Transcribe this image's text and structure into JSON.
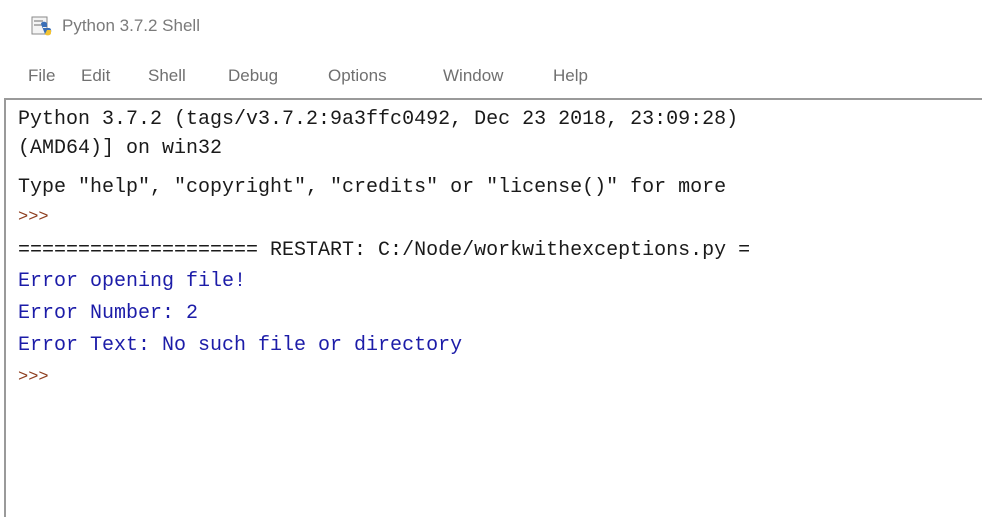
{
  "window": {
    "title": "Python 3.7.2 Shell"
  },
  "menu": {
    "items": [
      "File",
      "Edit",
      "Shell",
      "Debug",
      "Options",
      "Window",
      "Help"
    ]
  },
  "shell": {
    "lines": [
      "Python 3.7.2 (tags/v3.7.2:9a3ffc0492, Dec 23 2018, 23:09:28)",
      "(AMD64)] on win32",
      "Type \"help\", \"copyright\", \"credits\" or \"license()\" for more",
      ">>>",
      "==================== RESTART: C:/Node/workwithexceptions.py =",
      "Error opening file!",
      "Error Number: 2",
      "Error Text: No such file or directory",
      ">>>"
    ]
  },
  "colors": {
    "standard_text": "#1a1a1a",
    "output_text": "#1c1ca8",
    "prompt": "#8f3f1f",
    "chrome_text": "#707070"
  },
  "icons": {
    "app": "python-idle-icon"
  }
}
